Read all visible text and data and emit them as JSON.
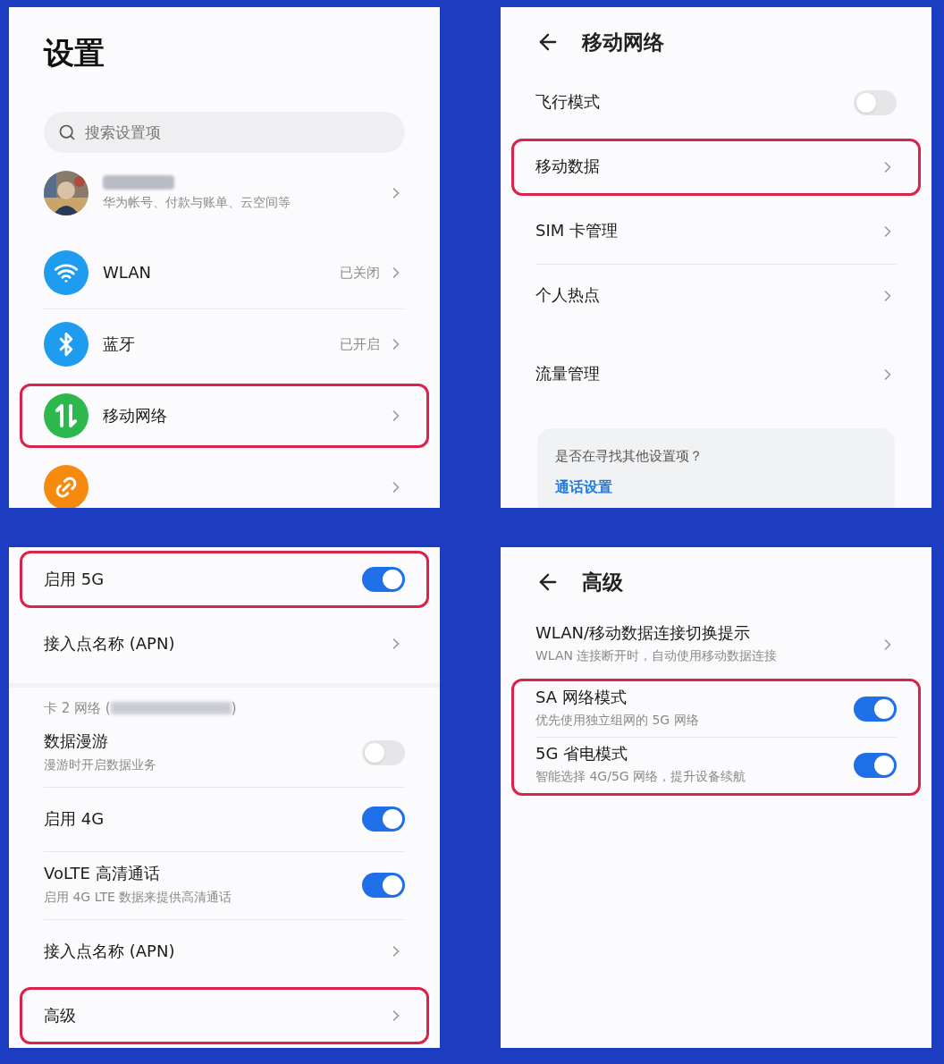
{
  "panels": [
    {
      "header": {
        "title": "设置",
        "back": false
      },
      "search": {
        "placeholder": "搜索设置项"
      },
      "items": [
        {
          "kind": "account",
          "subtitle": "华为帐号、付款与账单、云空间等"
        },
        {
          "kind": "gap"
        },
        {
          "kind": "nav-row",
          "leading": {
            "kind": "wifi"
          },
          "label": "WLAN",
          "value": "已关闭",
          "highlighted": false
        },
        {
          "kind": "nav-row",
          "leading": {
            "kind": "bluetooth"
          },
          "label": "蓝牙",
          "value": "已开启",
          "highlighted": false
        },
        {
          "kind": "nav-row",
          "leading": {
            "kind": "mobile"
          },
          "label": "移动网络",
          "highlighted": true
        },
        {
          "kind": "nav-row",
          "leading": {
            "kind": "link"
          },
          "highlighted": false
        }
      ]
    },
    {
      "header": {
        "title": "移动网络",
        "back": true
      },
      "items": [
        {
          "kind": "switch-row",
          "label": "飞行模式",
          "on": false,
          "highlighted": false
        },
        {
          "kind": "nav-row",
          "label": "移动数据",
          "highlighted": true
        },
        {
          "kind": "nav-row",
          "label": "SIM 卡管理",
          "highlighted": false
        },
        {
          "kind": "nav-row",
          "label": "个人热点",
          "highlighted": false
        },
        {
          "kind": "gap"
        },
        {
          "kind": "nav-row",
          "label": "流量管理",
          "highlighted": false
        },
        {
          "kind": "hint",
          "question": "是否在寻找其他设置项？",
          "link": "通话设置"
        }
      ]
    },
    {
      "items": [
        {
          "kind": "switch-row",
          "label": "启用 5G",
          "on": true,
          "highlighted": true
        },
        {
          "kind": "nav-row",
          "label": "接入点名称 (APN)",
          "highlighted": false
        },
        {
          "kind": "gap"
        },
        {
          "kind": "caption",
          "text": "卡 2 网络 (",
          "after": ")"
        },
        {
          "kind": "switch-row",
          "label": "数据漫游",
          "subtitle": "漫游时开启数据业务",
          "on": false,
          "highlighted": false
        },
        {
          "kind": "switch-row",
          "label": "启用 4G",
          "on": true,
          "highlighted": false
        },
        {
          "kind": "switch-row",
          "label": "VoLTE 高清通话",
          "subtitle": "启用 4G LTE 数据来提供高清通话",
          "on": true,
          "highlighted": false
        },
        {
          "kind": "nav-row",
          "label": "接入点名称 (APN)",
          "highlighted": false
        },
        {
          "kind": "nav-row",
          "label": "高级",
          "highlighted": true
        }
      ]
    },
    {
      "header": {
        "title": "高级",
        "back": true
      },
      "items": [
        {
          "kind": "nav-row",
          "label": "WLAN/移动数据连接切换提示",
          "subtitle": "WLAN 连接断开时，自动使用移动数据连接",
          "highlighted": false
        },
        {
          "kind": "group",
          "highlighted": true,
          "rows": [
            {
              "kind": "switch-row",
              "label": "SA 网络模式",
              "subtitle": "优先使用独立组网的 5G 网络",
              "on": true
            },
            {
              "kind": "switch-row",
              "label": "5G 省电模式",
              "subtitle": "智能选择 4G/5G 网络，提升设备续航",
              "on": true
            }
          ]
        }
      ]
    }
  ]
}
